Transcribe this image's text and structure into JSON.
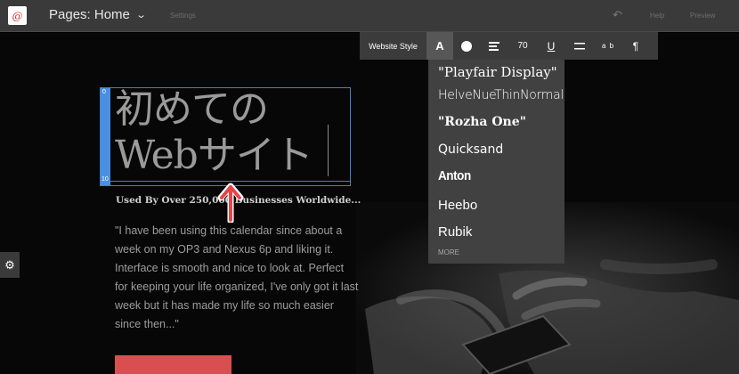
{
  "topbar": {
    "page_selector": "Pages: Home",
    "settings": "Settings",
    "help": "Help",
    "preview": "Preview",
    "undo_icon": "undo-icon"
  },
  "toolbar": {
    "website_style": "Website Style",
    "font_label": "A",
    "font_size": "70",
    "underline": "U",
    "spacing": "a b",
    "paragraph": "¶"
  },
  "font_menu": {
    "fonts": [
      "\"Playfair Display\"",
      "HelveNueThinNormal",
      "\"Rozha One\"",
      "Quicksand",
      "Anton",
      "Heebo",
      "Rubik"
    ],
    "more": "MORE"
  },
  "heading": {
    "line1": "初めての",
    "line2": "Webサイト",
    "top_marker": "0",
    "bottom_marker": "10"
  },
  "content": {
    "subtitle": "Used By Over 250,000 Businesses Worldwide...",
    "quote": "\"I have been using this calendar since about a week on my OP3 and Nexus 6p and liking it. Interface is smooth and nice to look at. Perfect for keeping your life organized, I've only got it last week but it has made my life so much easier since then...\""
  },
  "colors": {
    "accent_blue": "#4a90e2",
    "cta_red": "#d94f4f",
    "arrow_red": "#e84545",
    "toolbar_bg": "#3b3b3b"
  }
}
